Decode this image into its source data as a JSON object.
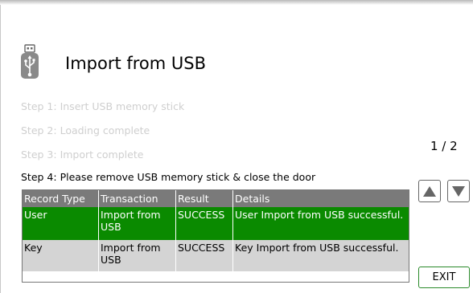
{
  "header": {
    "title": "Import from USB",
    "icon": "usb-stick-icon"
  },
  "steps": [
    {
      "label": "Step 1: Insert USB memory stick",
      "active": false
    },
    {
      "label": "Step 2: Loading complete",
      "active": false
    },
    {
      "label": "Step 3: Import complete",
      "active": false
    },
    {
      "label": "Step 4: Please remove USB memory stick & close the door",
      "active": true
    }
  ],
  "pagination": {
    "label": "1 / 2",
    "up_icon": "arrow-up-icon",
    "down_icon": "arrow-down-icon"
  },
  "table": {
    "columns": [
      "Record Type",
      "Transaction",
      "Result",
      "Details"
    ],
    "rows": [
      {
        "record_type": "User",
        "transaction": "Import from USB",
        "result": "SUCCESS",
        "details": "User Import from USB successful.",
        "highlight": "#0a8a00"
      },
      {
        "record_type": "Key",
        "transaction": "Import from USB",
        "result": "SUCCESS",
        "details": "Key Import from USB successful.",
        "highlight": "#d4d4d4"
      }
    ]
  },
  "buttons": {
    "exit_label": "EXIT"
  },
  "colors": {
    "selected_row": "#0a8a00",
    "header_row": "#7a7a7a",
    "inactive_step": "#cfcfcf",
    "exit_border": "#2a8a2a"
  }
}
